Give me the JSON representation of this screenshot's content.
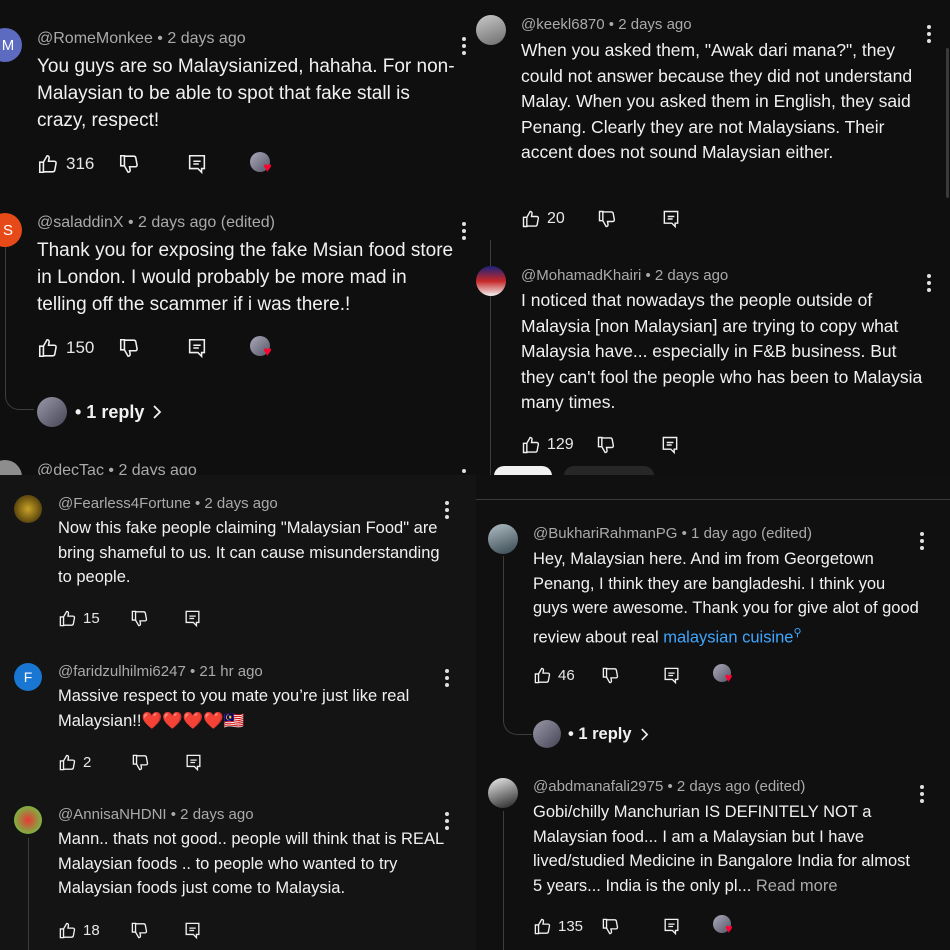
{
  "top_left": {
    "c1": {
      "handle": "@RomeMonkee",
      "time": "• 2 days ago",
      "avatar_letter": "M",
      "text": "You guys are so Malaysianized, hahaha. For non-Malaysian to be able to spot that fake stall is crazy, respect!",
      "likes": "316"
    },
    "c2": {
      "handle": "@saladdinX",
      "time": "• 2 days ago (edited)",
      "avatar_letter": "S",
      "text": "Thank you for exposing the fake Msian food store in London. I would probably be more mad in  telling off the scammer if i was there.!",
      "likes": "150",
      "reply_label": "• 1 reply"
    },
    "c3": {
      "handle": "@decTac",
      "time": "• 2 days ago"
    }
  },
  "top_right": {
    "c1": {
      "handle": "@keekl6870",
      "time": "• 2 days ago",
      "text": "When you asked them, \"Awak dari mana?\", they could not answer because they did not understand Malay. When you asked them in English, they said Penang. Clearly they are not Malaysians. Their accent does not sound Malaysian either.",
      "likes": "20"
    },
    "c2": {
      "handle": "@MohamadKhairi",
      "time": "• 2 days ago",
      "text": "I noticed that nowadays the people outside of Malaysia [non Malaysian] are trying to copy what Malaysia have... especially in F&B business. But they can't fool the people who has been to Malaysia many times.",
      "likes": "129"
    }
  },
  "bottom_left": {
    "c1": {
      "handle": "@Fearless4Fortune",
      "time": "• 2 days ago",
      "text": "Now this fake people claiming \"Malaysian Food\" are bring shameful to us. It can cause misunderstanding to people.",
      "likes": "15"
    },
    "c2": {
      "handle": "@faridzulhilmi6247",
      "time": "• 21 hr ago",
      "avatar_letter": "F",
      "text": "Massive respect to you mate you’re just like real Malaysian!!",
      "emojis": "❤️❤️❤️❤️🇲🇾",
      "likes": "2"
    },
    "c3": {
      "handle": "@AnnisaNHDNI",
      "time": "• 2 days ago",
      "text": "Mann.. thats not good.. people will think that is REAL Malaysian foods .. to people who wanted to try Malaysian foods just come to Malaysia.",
      "likes": "18"
    }
  },
  "bottom_right": {
    "c1": {
      "handle": "@BukhariRahmanPG",
      "time": "• 1 day ago (edited)",
      "text": "Hey, Malaysian here. And im from Georgetown Penang, I think they are bangladeshi. I think you guys were awesome. Thank you for give alot of good review about real ",
      "link": "malaysian cuisine",
      "likes": "46",
      "reply_label": "• 1 reply"
    },
    "c2": {
      "handle": "@abdmanafali2975",
      "time": "• 2 days ago (edited)",
      "text": "Gobi/chilly Manchurian IS DEFINITELY NOT a Malaysian food... I am a Malaysian but I have lived/studied Medicine in Bangalore India for almost 5 years... India is the only pl...",
      "read_more": "Read more",
      "likes": "135"
    }
  },
  "colors": {
    "bg": "#0f0f0f",
    "text": "#f1f1f1",
    "meta": "#aaaaaa",
    "link": "#3ea6ff",
    "heart": "#ff0033"
  }
}
